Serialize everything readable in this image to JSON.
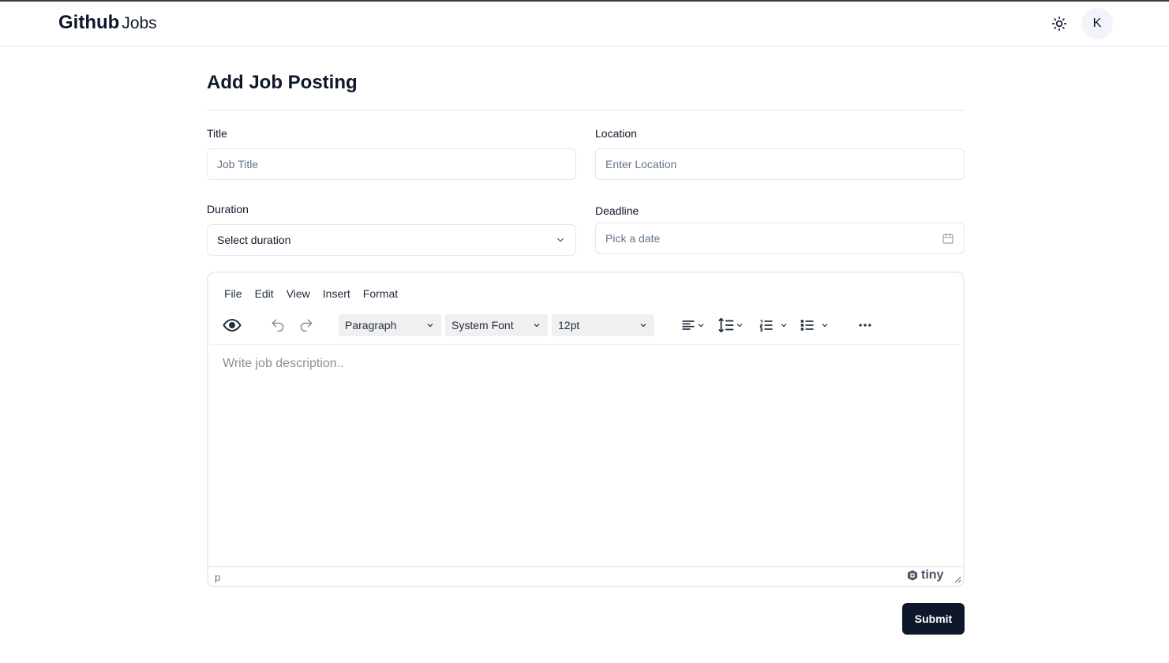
{
  "header": {
    "brand_bold": "Github",
    "brand_light": "Jobs",
    "avatar_initial": "K"
  },
  "page": {
    "title": "Add Job Posting"
  },
  "form": {
    "title_label": "Title",
    "title_placeholder": "Job Title",
    "location_label": "Location",
    "location_placeholder": "Enter Location",
    "duration_label": "Duration",
    "duration_value": "Select duration",
    "deadline_label": "Deadline",
    "deadline_placeholder": "Pick a date"
  },
  "editor": {
    "menu": [
      "File",
      "Edit",
      "View",
      "Insert",
      "Format"
    ],
    "block_format": "Paragraph",
    "font_family": "System Font",
    "font_size": "12pt",
    "placeholder": "Write job description..",
    "status_path": "p",
    "brand": "tiny"
  },
  "actions": {
    "submit_label": "Submit"
  },
  "colors": {
    "primary": "#0f172a",
    "border": "#e2e8f0",
    "muted": "#64748b"
  }
}
